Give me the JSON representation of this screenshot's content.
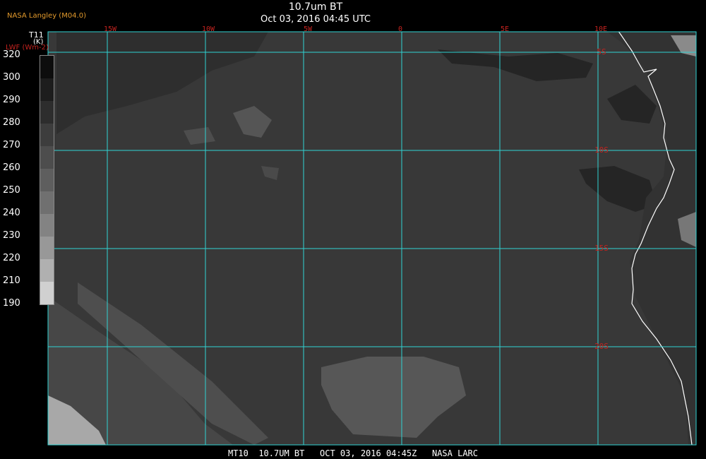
{
  "header": {
    "credit": "NASA Langley (M04.0)",
    "title": "10.7um BT",
    "subtitle": "Oct 03, 2016 04:45 UTC"
  },
  "colorbar": {
    "title": "T11",
    "unit": "(K)",
    "subtitle": "LWF (Wm-2)",
    "ticks": [
      "320",
      "300",
      "290",
      "280",
      "270",
      "260",
      "250",
      "240",
      "230",
      "220",
      "210",
      "190"
    ],
    "shades": [
      "#0d0d0d",
      "#1d1d1d",
      "#2d2d2d",
      "#3d3d3d",
      "#4d4d4d",
      "#5e5e5e",
      "#707070",
      "#838383",
      "#989898",
      "#b0b0b0",
      "#d0d0d0"
    ]
  },
  "map": {
    "lon_labels": [
      "15W",
      "10W",
      "5W",
      "0",
      "5E",
      "10E"
    ],
    "lat_labels": [
      "5S",
      "10S",
      "15S",
      "20S"
    ],
    "grid_color": "#2fd3d3",
    "label_color": "#c4231f",
    "background": "#383838"
  },
  "footer": "MT10  10.7UM BT   OCT 03, 2016 04:45Z   NASA LARC"
}
